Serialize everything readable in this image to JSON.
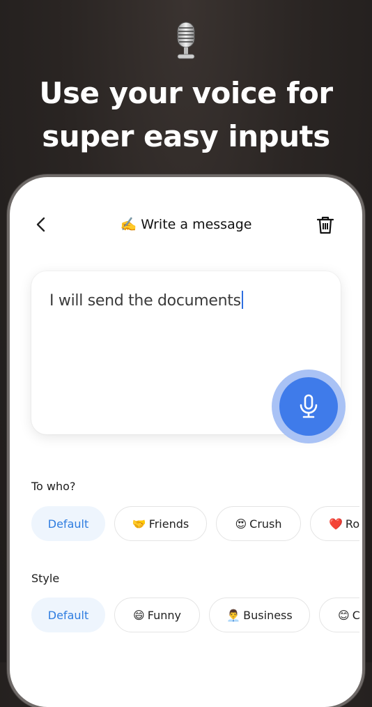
{
  "headline": {
    "line1": "Use your voice for",
    "line2": "super easy inputs"
  },
  "nav": {
    "title_emoji": "✍️",
    "title": "Write a message"
  },
  "message": {
    "text": "I will send the documents"
  },
  "to_who": {
    "label": "To who?",
    "chips": [
      {
        "emoji": "",
        "label": "Default",
        "selected": true
      },
      {
        "emoji": "🤝",
        "label": "Friends",
        "selected": false
      },
      {
        "emoji": "😍",
        "label": "Crush",
        "selected": false
      },
      {
        "emoji": "❤️",
        "label": "Ro",
        "selected": false
      }
    ]
  },
  "style": {
    "label": "Style",
    "chips": [
      {
        "emoji": "",
        "label": "Default",
        "selected": true
      },
      {
        "emoji": "😄",
        "label": "Funny",
        "selected": false
      },
      {
        "emoji": "👨‍💼",
        "label": "Business",
        "selected": false
      },
      {
        "emoji": "😊",
        "label": "C",
        "selected": false
      }
    ]
  },
  "colors": {
    "accent": "#3f7bea",
    "chip_selected_bg": "#eef5fd",
    "chip_selected_text": "#2f7de0"
  }
}
